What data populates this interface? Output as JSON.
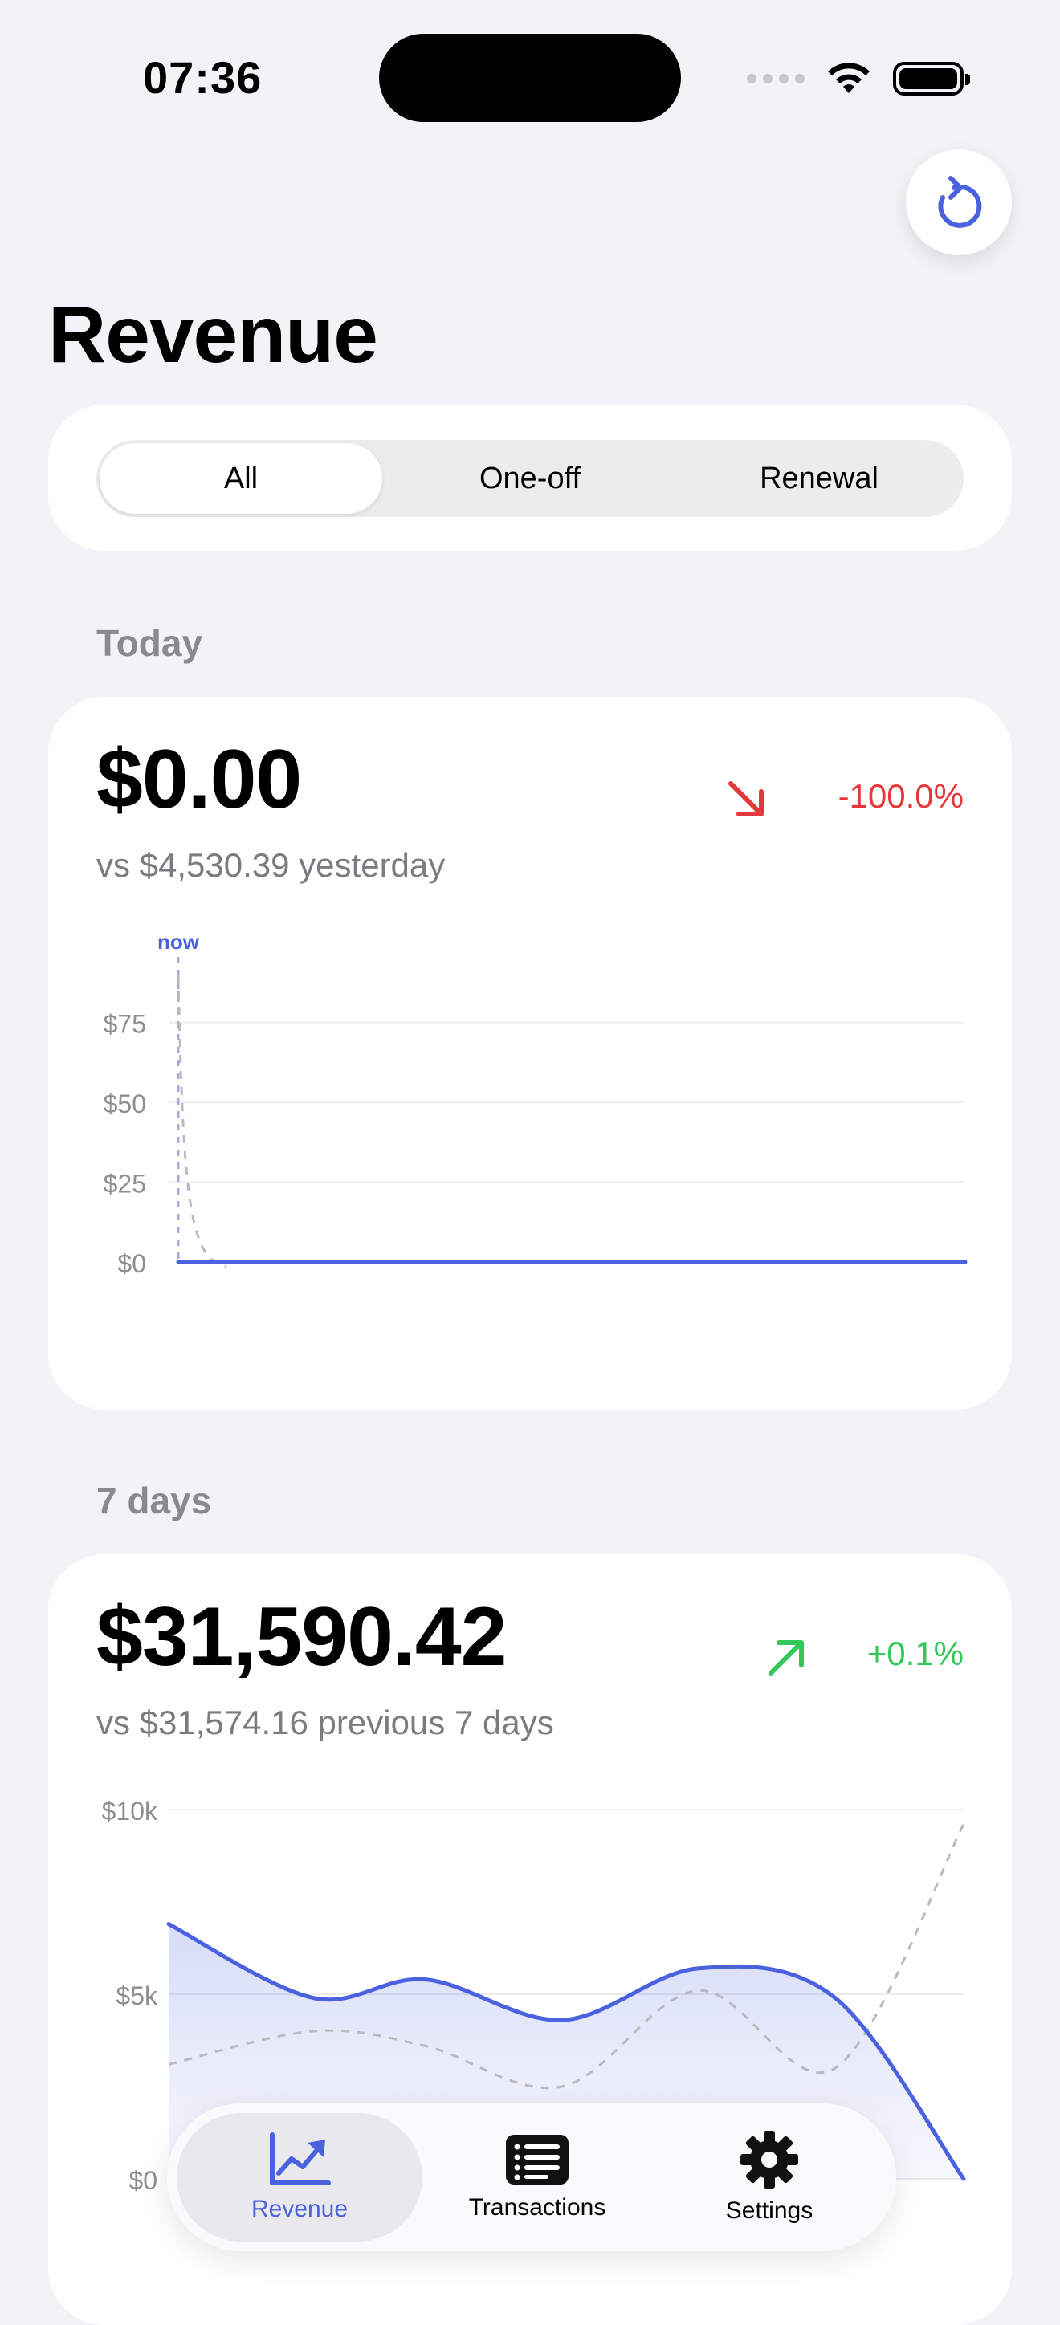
{
  "status_bar": {
    "time": "07:36"
  },
  "header": {
    "title": "Revenue",
    "refresh_icon": "refresh-icon"
  },
  "segments": {
    "items": [
      "All",
      "One-off",
      "Renewal"
    ],
    "selected": "All"
  },
  "colors": {
    "accent": "#4a62de",
    "negative": "#e5383b",
    "positive": "#34c759",
    "secondary_text": "#7c7c80"
  },
  "today": {
    "label": "Today",
    "amount": "$0.00",
    "compare": "vs $4,530.39 yesterday",
    "change": "-100.0%",
    "trend": "down",
    "chart_data": {
      "type": "line",
      "y_ticks": [
        "$75",
        "$50",
        "$25",
        "$0"
      ],
      "ylim": [
        0,
        90
      ],
      "now_label": "now",
      "series": [
        {
          "values": [
            0,
            0
          ]
        },
        {
          "values": [
            90,
            0
          ]
        }
      ]
    }
  },
  "seven_days": {
    "label": "7 days",
    "amount": "$31,590.42",
    "compare": "vs $31,574.16 previous 7 days",
    "change": "+0.1%",
    "trend": "up",
    "chart_data": {
      "type": "area",
      "y_ticks": [
        "$10k",
        "$5k",
        "$0"
      ],
      "ylim": [
        0,
        10000
      ],
      "series": [
        {
          "values": [
            6900,
            4900,
            5400,
            4300,
            5700,
            4900,
            0
          ]
        },
        {
          "values": [
            3100,
            4000,
            3600,
            2500,
            5100,
            3000,
            9600
          ]
        }
      ]
    }
  },
  "tab_bar": {
    "items": [
      {
        "label": "Revenue",
        "icon": "chart-trend-icon",
        "active": true
      },
      {
        "label": "Transactions",
        "icon": "list-icon",
        "active": false
      },
      {
        "label": "Settings",
        "icon": "gear-icon",
        "active": false
      }
    ]
  }
}
